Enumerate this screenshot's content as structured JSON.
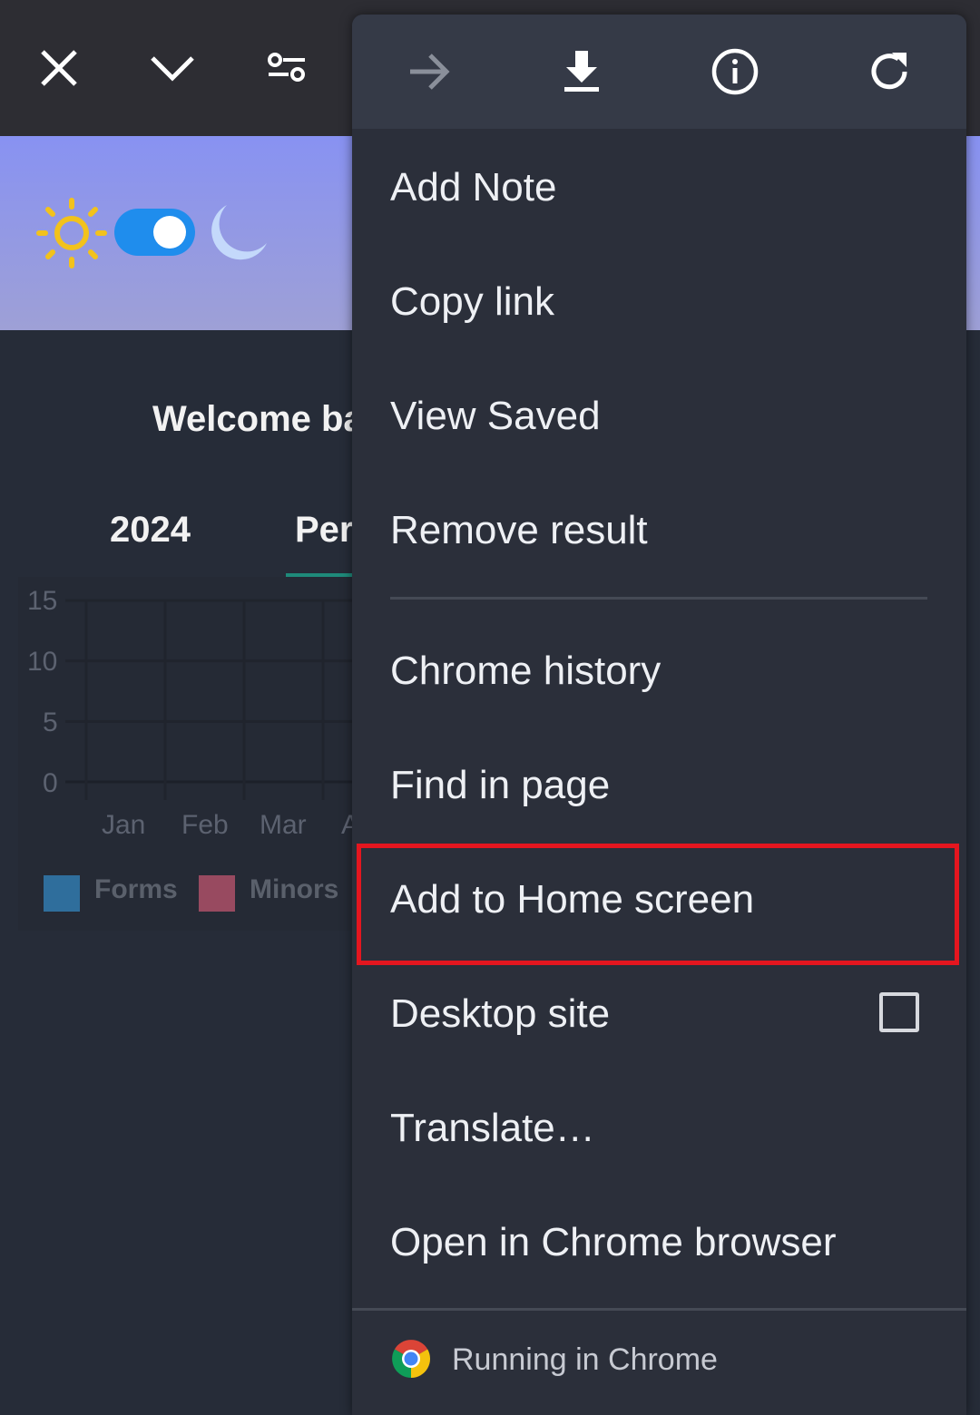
{
  "topbar": {
    "icons": [
      "close-icon",
      "chevron-down-icon",
      "tune-icon"
    ]
  },
  "banner": {
    "theme_toggle": {
      "on": true
    },
    "icons": [
      "sun-icon",
      "moon-icon"
    ]
  },
  "page": {
    "welcome": "Welcome ba",
    "tabs": [
      {
        "label": "2024"
      },
      {
        "label": "Per",
        "active": true
      }
    ]
  },
  "chart_data": {
    "type": "bar",
    "categories": [
      "Jan",
      "Feb",
      "Mar",
      "A"
    ],
    "series": [
      {
        "name": "Forms",
        "color": "#2f6e9c",
        "values": []
      },
      {
        "name": "Minors",
        "color": "#984a60",
        "values": []
      }
    ],
    "yticks": [
      "15",
      "10",
      "5",
      "0"
    ],
    "ylim": [
      0,
      15
    ],
    "grid": true,
    "legend": "bottom"
  },
  "menu": {
    "top_icons": [
      "forward-arrow-icon",
      "download-icon",
      "info-icon",
      "refresh-icon"
    ],
    "items": [
      {
        "label": "Add Note"
      },
      {
        "label": "Copy link"
      },
      {
        "label": "View Saved"
      },
      {
        "label": "Remove result"
      },
      {
        "label": "Chrome history"
      },
      {
        "label": "Find in page"
      },
      {
        "label": "Add to Home screen",
        "highlighted": true
      },
      {
        "label": "Desktop site",
        "checked": false
      },
      {
        "label": "Translate…"
      },
      {
        "label": "Open in Chrome browser"
      }
    ],
    "footer": "Running in Chrome",
    "highlight_color": "#e4161f"
  }
}
